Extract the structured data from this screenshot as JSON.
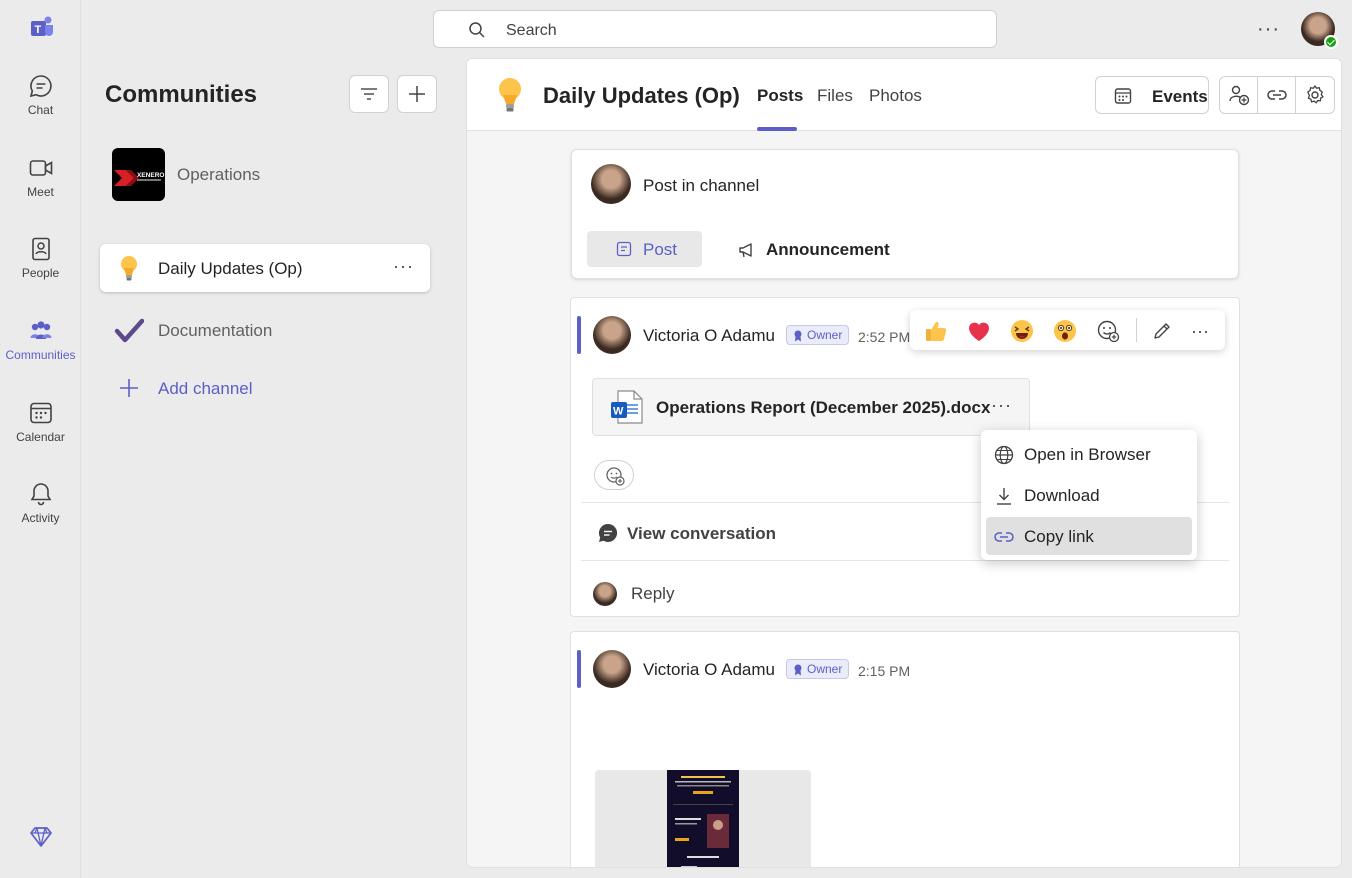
{
  "rail": {
    "items": [
      {
        "label": "Chat",
        "icon": "chat-icon"
      },
      {
        "label": "Meet",
        "icon": "video-icon"
      },
      {
        "label": "People",
        "icon": "people-icon"
      },
      {
        "label": "Communities",
        "icon": "communities-icon",
        "active": true
      },
      {
        "label": "Calendar",
        "icon": "calendar-icon"
      },
      {
        "label": "Activity",
        "icon": "bell-icon"
      }
    ]
  },
  "search": {
    "placeholder": "Search"
  },
  "pane": {
    "title": "Communities",
    "community_name": "Operations",
    "community_logo_text": "XENERO",
    "channels": [
      {
        "name": "Daily Updates (Op)",
        "icon": "lightbulb-icon",
        "active": true
      },
      {
        "name": "Documentation",
        "icon": "checkmark-icon"
      }
    ],
    "add_channel": "Add channel"
  },
  "header": {
    "title": "Daily Updates (Op)",
    "tabs": [
      "Posts",
      "Files",
      "Photos"
    ],
    "active_tab": "Posts",
    "events_label": "Events"
  },
  "compose": {
    "placeholder": "Post in channel",
    "post_label": "Post",
    "announcement_label": "Announcement"
  },
  "messages": [
    {
      "author": "Victoria O Adamu",
      "badge": "Owner",
      "time": "2:52 PM",
      "file_name": "Operations Report (December 2025).docx",
      "view_conversation": "View conversation",
      "reply": "Reply"
    },
    {
      "author": "Victoria O Adamu",
      "badge": "Owner",
      "time": "2:15 PM"
    }
  ],
  "reactions": [
    "thumbs-up",
    "heart",
    "laughing",
    "surprised"
  ],
  "context_menu": {
    "items": [
      {
        "label": "Open in Browser",
        "icon": "globe-icon"
      },
      {
        "label": "Download",
        "icon": "download-icon"
      },
      {
        "label": "Copy link",
        "icon": "link-icon",
        "highlighted": true
      }
    ]
  },
  "colors": {
    "accent": "#5b5fc7",
    "presence": "#13a10e"
  }
}
